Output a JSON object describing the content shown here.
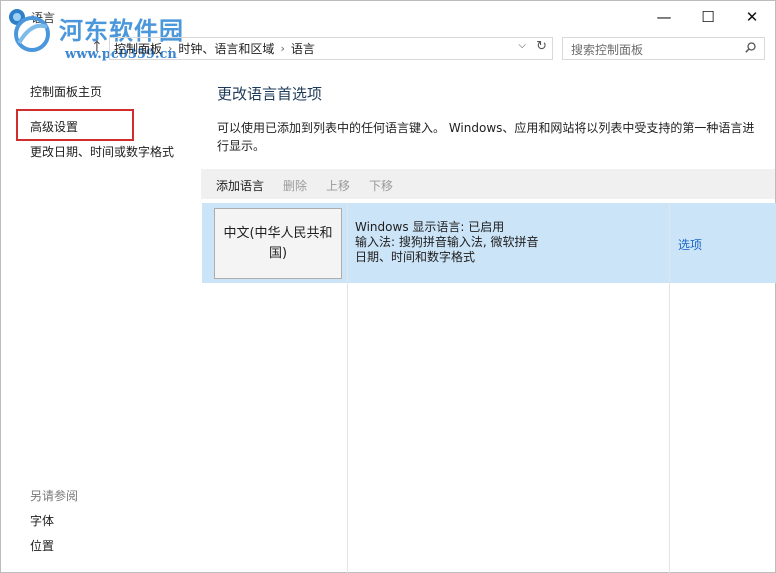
{
  "window": {
    "title": "语言",
    "minimize": "—",
    "maximize": "☐",
    "close": "✕"
  },
  "watermark": {
    "name": "河东软件园",
    "url": "www.pc0359.cn"
  },
  "nav": {
    "back": "←",
    "up": "↑",
    "breadcrumb": [
      "控制面板",
      "时钟、语言和区域",
      "语言"
    ],
    "separator": "›",
    "dropdown": "⌵",
    "refresh": "↻",
    "search_placeholder": "搜索控制面板"
  },
  "sidebar": {
    "home": "控制面板主页",
    "advanced": "高级设置",
    "change_format": "更改日期、时间或数字格式",
    "see_also": "另请参阅",
    "fonts": "字体",
    "location": "位置"
  },
  "main": {
    "heading": "更改语言首选项",
    "description": "可以使用已添加到列表中的任何语言键入。 Windows、应用和网站将以列表中受支持的第一种语言进行显示。",
    "toolbar": {
      "add": "添加语言",
      "remove": "删除",
      "move_up": "上移",
      "move_down": "下移"
    },
    "languages": [
      {
        "name": "中文(中华人民共和国)",
        "display_language": "Windows 显示语言: 已启用",
        "input_methods": "输入法: 搜狗拼音输入法, 微软拼音",
        "format": "日期、时间和数字格式",
        "options": "选项"
      }
    ]
  },
  "colors": {
    "selected_row": "#cce4f7",
    "link": "#1a68c6",
    "highlight_border": "#d12d2d",
    "watermark": "#4a97dc"
  }
}
